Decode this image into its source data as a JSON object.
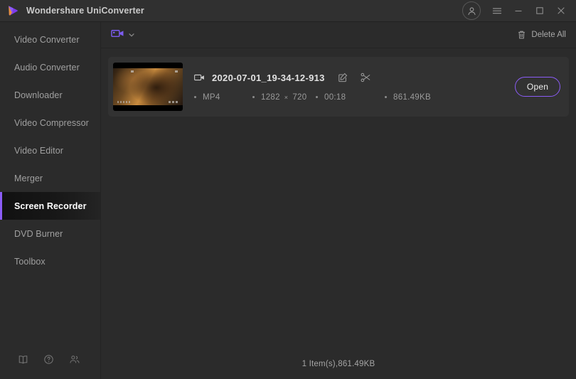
{
  "titlebar": {
    "app_title": "Wondershare UniConverter",
    "logo_name": "wondershare-logo",
    "account_icon": "account-avatar-icon",
    "menu_icon": "hamburger-menu-icon",
    "minimize_icon": "minimize-icon",
    "maximize_icon": "maximize-icon",
    "close_icon": "close-icon",
    "accent": "#7c4dff"
  },
  "sidebar": {
    "items": [
      {
        "label": "Video Converter",
        "active": false
      },
      {
        "label": "Audio Converter",
        "active": false
      },
      {
        "label": "Downloader",
        "active": false
      },
      {
        "label": "Video Compressor",
        "active": false
      },
      {
        "label": "Video Editor",
        "active": false
      },
      {
        "label": "Merger",
        "active": false
      },
      {
        "label": "Screen Recorder",
        "active": true
      },
      {
        "label": "DVD Burner",
        "active": false
      },
      {
        "label": "Toolbox",
        "active": false
      }
    ],
    "active_accent": "#8b5cf6",
    "footer_icons": [
      {
        "name": "user-guide-book-icon"
      },
      {
        "name": "help-question-icon"
      },
      {
        "name": "community-people-icon"
      }
    ]
  },
  "toolbar": {
    "format_icon": "video-camera-icon",
    "format_icon_color": "#7c5cf0",
    "dropdown_icon": "chevron-down-icon",
    "delete_all_label": "Delete All",
    "delete_all_icon": "trash-icon"
  },
  "files": [
    {
      "name": "2020-07-01_19-34-12-913",
      "type_icon": "video-camera-icon",
      "edit_icon": "edit-pencil-icon",
      "trim_icon": "scissors-trim-icon",
      "format": "MP4",
      "width": "1282",
      "res_sep": "×",
      "height": "720",
      "duration": "00:18",
      "size": "861.49KB",
      "open_label": "Open",
      "open_accent": "#8b5cf6"
    }
  ],
  "statusbar": {
    "summary": "1 Item(s),861.49KB"
  }
}
